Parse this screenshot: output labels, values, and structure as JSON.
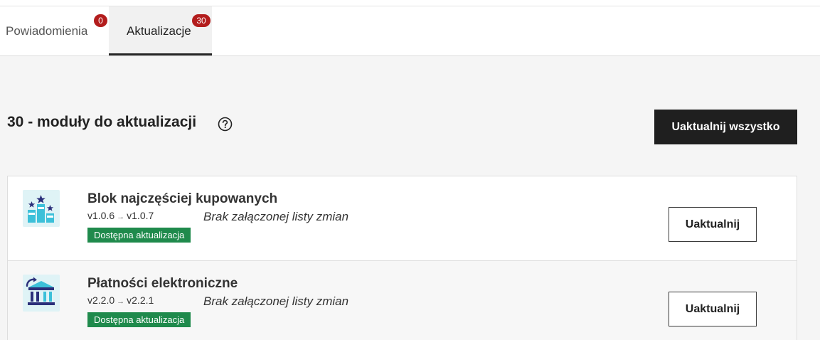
{
  "tabs": [
    {
      "label": "Powiadomienia",
      "badge": "0"
    },
    {
      "label": "Aktualizacje",
      "badge": "30",
      "active": true
    }
  ],
  "section": {
    "title": "30 - moduły do aktualizacji",
    "help_icon": "question-circle-icon",
    "update_all_label": "Uaktualnij wszystko"
  },
  "modules": [
    {
      "name": "Blok najczęściej kupowanych",
      "icon": "podium-stars-icon",
      "from_version": "v1.0.6",
      "to_version": "v1.0.7",
      "changelog": "Brak załączonej listy zmian",
      "status": "Dostępna aktualizacja",
      "button_label": "Uaktualnij"
    },
    {
      "name": "Płatności elektroniczne",
      "icon": "bank-payment-icon",
      "from_version": "v2.2.0",
      "to_version": "v2.2.1",
      "changelog": "Brak załączonej listy zmian",
      "status": "Dostępna aktualizacja",
      "button_label": "Uaktualnij"
    }
  ],
  "colors": {
    "badge": "#b31d1d",
    "status_green": "#1f8a4c",
    "primary_button": "#1f1f1f",
    "icon_bg": "#dff3f6"
  }
}
